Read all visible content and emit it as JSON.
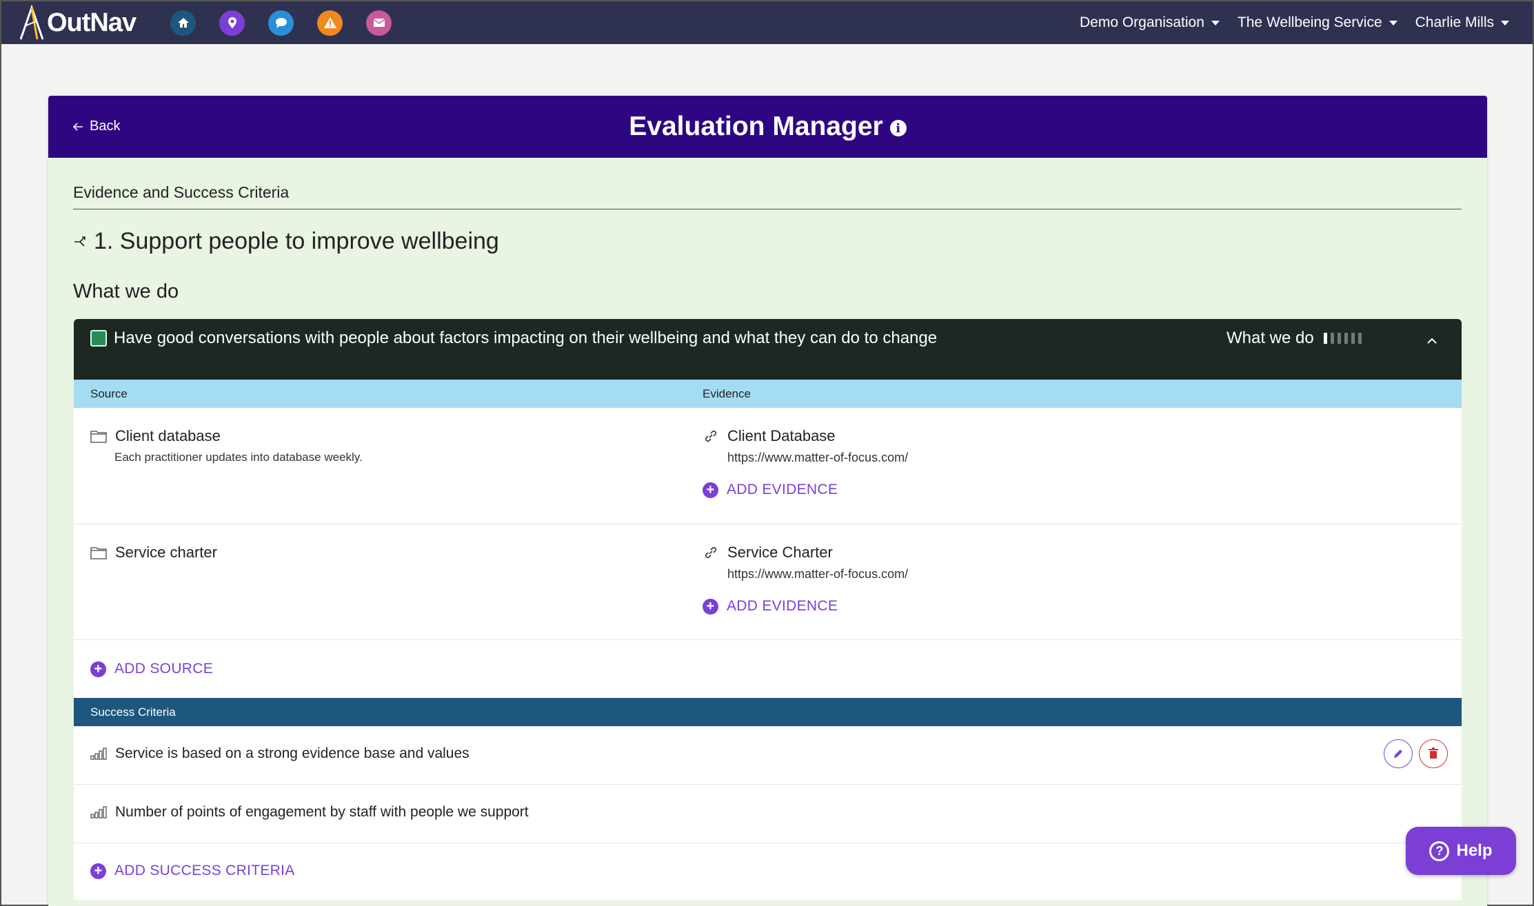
{
  "app": {
    "logo_text": "OutNav",
    "nav_icons": [
      {
        "name": "home-icon",
        "color": "#1d577e"
      },
      {
        "name": "location-pin-icon",
        "color": "#7b3fd6"
      },
      {
        "name": "chat-icon",
        "color": "#2b8fd6"
      },
      {
        "name": "warning-icon",
        "color": "#f0891d"
      },
      {
        "name": "mail-icon",
        "color": "#c85a9a"
      }
    ],
    "menus": {
      "organisation": "Demo Organisation",
      "service": "The Wellbeing Service",
      "user": "Charlie Mills"
    }
  },
  "header": {
    "back_label": "Back",
    "title": "Evaluation Manager"
  },
  "section_label": "Evidence and Success Criteria",
  "outcome_title": "1. Support people to improve wellbeing",
  "what_we_do_heading": "What we do",
  "activity": {
    "text": "Have good conversations with people about factors impacting on their wellbeing and what they can do to change",
    "badge_label": "What we do",
    "level_filled": 1,
    "level_total": 6,
    "checkbox_color": "#2b8a55"
  },
  "sources_table": {
    "col_source": "Source",
    "col_evidence": "Evidence",
    "rows": [
      {
        "source": "Client database",
        "source_desc": "Each practitioner updates into database weekly.",
        "evidence_name": "Client Database",
        "evidence_url": "https://www.matter-of-focus.com/",
        "add_evidence": "ADD EVIDENCE"
      },
      {
        "source": "Service charter",
        "source_desc": "",
        "evidence_name": "Service Charter",
        "evidence_url": "https://www.matter-of-focus.com/",
        "add_evidence": "ADD EVIDENCE"
      }
    ],
    "add_source": "ADD SOURCE"
  },
  "success_criteria": {
    "heading": "Success Criteria",
    "items": [
      "Service is based on a strong evidence base and values",
      "Number of points of engagement by staff with people we support"
    ],
    "add_label": "ADD SUCCESS CRITERIA"
  },
  "help_label": "Help",
  "colors": {
    "nav_bg": "#2f3151",
    "header_bg": "#2e0682",
    "accent": "#7b3fd6",
    "panel_dark": "#1d2823",
    "source_head": "#a4dcf3",
    "criteria_head": "#1d577e",
    "card_bg": "#e9f4e3"
  }
}
